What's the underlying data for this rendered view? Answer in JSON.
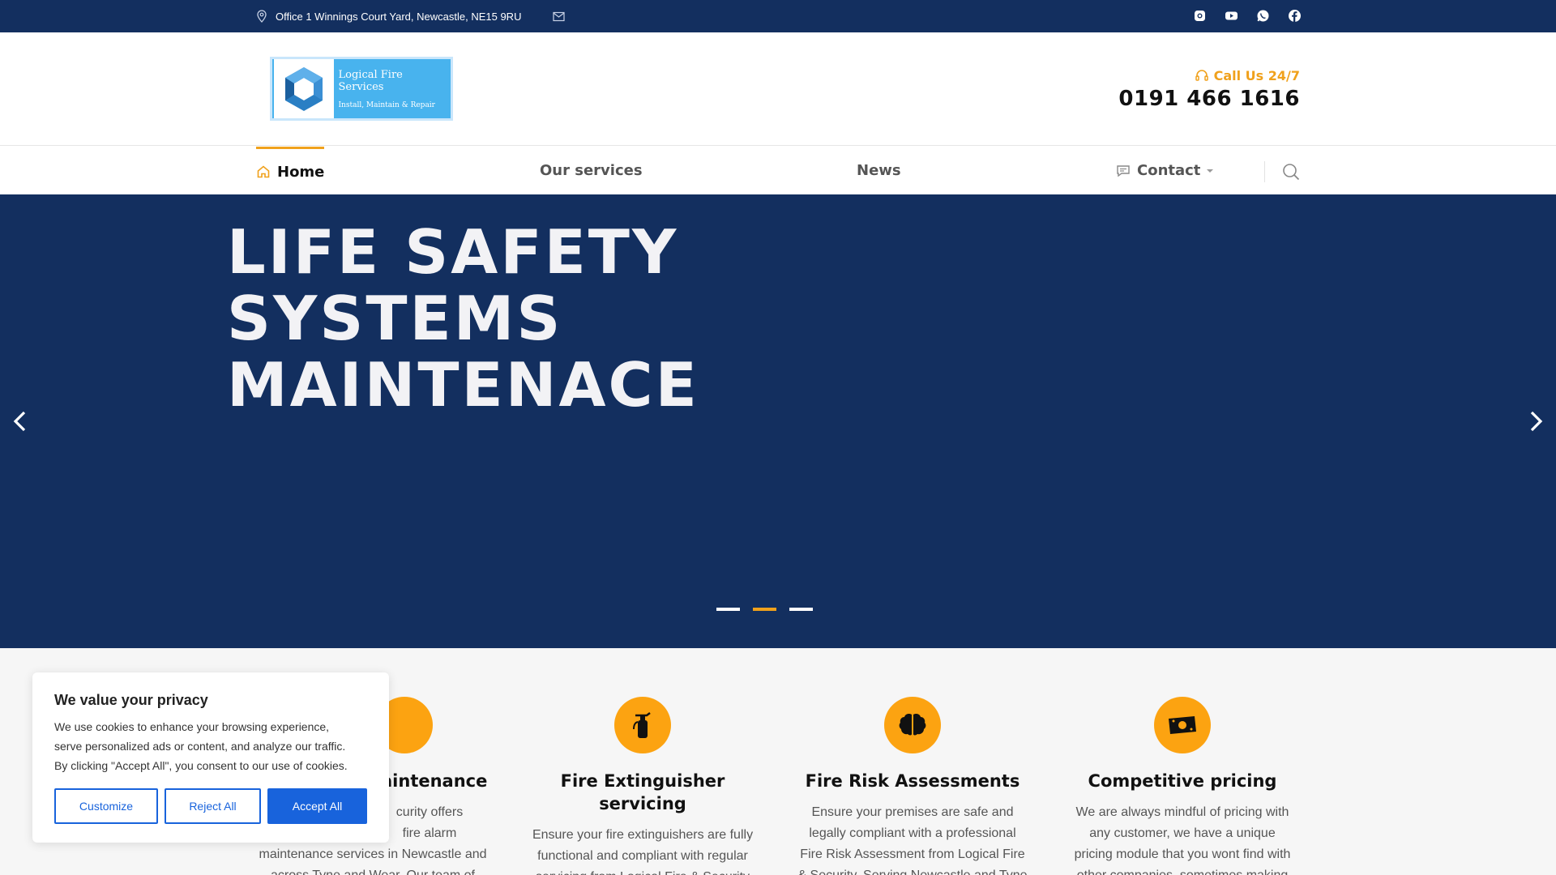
{
  "topbar": {
    "address": "Office 1 Winnings Court Yard, Newcastle, NE15 9RU",
    "socials": [
      "instagram-icon",
      "youtube-icon",
      "whatsapp-icon",
      "facebook-icon"
    ]
  },
  "header": {
    "logo_title": "Logical Fire Services",
    "logo_tagline": "Install, Maintain & Repair",
    "call_label": "Call Us 24/7",
    "phone": "0191 466 1616"
  },
  "nav": {
    "items": [
      {
        "label": "Home"
      },
      {
        "label": "Our services"
      },
      {
        "label": "News"
      },
      {
        "label": "Contact"
      }
    ]
  },
  "hero": {
    "line1": "LIFE SAFETY",
    "line2": "SYSTEMS",
    "line3": "MAINTENACE"
  },
  "features": [
    {
      "title": "Fire Alarm Maintenance",
      "title_visible": "aintenance",
      "text_lines": [
        "curity offers",
        "fire alarm",
        "maintenance services in Newcastle and",
        "across Tyne and Wear. Our team of"
      ]
    },
    {
      "title_l1": "Fire Extinguisher",
      "title_l2": "servicing",
      "text_lines": [
        "Ensure your fire extinguishers are fully",
        "functional and compliant with regular",
        "servicing from Logical Fire & Security"
      ]
    },
    {
      "title": "Fire Risk Assessments",
      "text_lines": [
        "Ensure your premises are safe and",
        "legally compliant with a professional",
        "Fire Risk Assessment from Logical Fire",
        "& Security. Serving Newcastle and Tyne"
      ]
    },
    {
      "title": "Competitive pricing",
      "text_lines": [
        "We are always mindful of pricing with",
        "any customer, we have a unique",
        "pricing module that you wont find with",
        "other companies, sometimes making"
      ]
    }
  ],
  "cookie": {
    "title": "We value your privacy",
    "text_l1": "We use cookies to enhance your browsing experience,",
    "text_l2": "serve personalized ads or content, and analyze our traffic.",
    "text_l3": "By clicking \"Accept All\", you consent to our use of cookies.",
    "customize": "Customize",
    "reject": "Reject All",
    "accept": "Accept All"
  },
  "colors": {
    "navy": "#132f5f",
    "accent": "#f0a11c",
    "cookie_blue": "#1863dc"
  }
}
